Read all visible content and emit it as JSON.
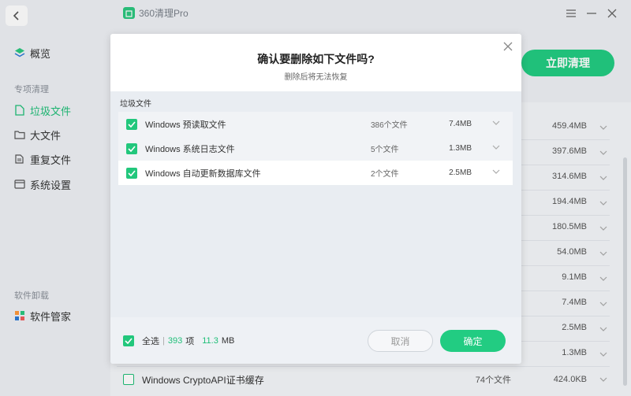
{
  "window": {
    "app_title": "360清理Pro"
  },
  "sidebar": {
    "overview": "概览",
    "section_special": "专项清理",
    "items": [
      {
        "label": "垃圾文件",
        "active": true
      },
      {
        "label": "大文件",
        "active": false
      },
      {
        "label": "重复文件",
        "active": false
      },
      {
        "label": "系统设置",
        "active": false
      }
    ],
    "section_uninstall": "软件卸载",
    "software_manager": "软件管家"
  },
  "header": {
    "clean_now_label": "立即清理"
  },
  "background_list": {
    "sizes": [
      "459.4MB",
      "397.6MB",
      "314.6MB",
      "194.4MB",
      "180.5MB",
      "54.0MB",
      "9.1MB",
      "7.4MB",
      "2.5MB",
      "1.3MB"
    ],
    "bottom_row": {
      "name": "Windows CryptoAPI证书缓存",
      "count": "74个文件",
      "size": "424.0KB"
    }
  },
  "dialog": {
    "title": "确认要删除如下文件吗?",
    "subtitle": "删除后将无法恢复",
    "section_label": "垃圾文件",
    "files": [
      {
        "name": "Windows 预读取文件",
        "count": "386个文件",
        "size": "7.4MB"
      },
      {
        "name": "Windows 系统日志文件",
        "count": "5个文件",
        "size": "1.3MB"
      },
      {
        "name": "Windows 自动更新数据库文件",
        "count": "2个文件",
        "size": "2.5MB"
      }
    ],
    "footer": {
      "select_all": "全选",
      "item_count": "393",
      "item_unit": "项",
      "size_num": "11.3",
      "size_unit": "MB",
      "cancel_label": "取消",
      "confirm_label": "确定"
    }
  },
  "colors": {
    "accent": "#22cc82",
    "sidebar_bg": "#eef1f5"
  }
}
